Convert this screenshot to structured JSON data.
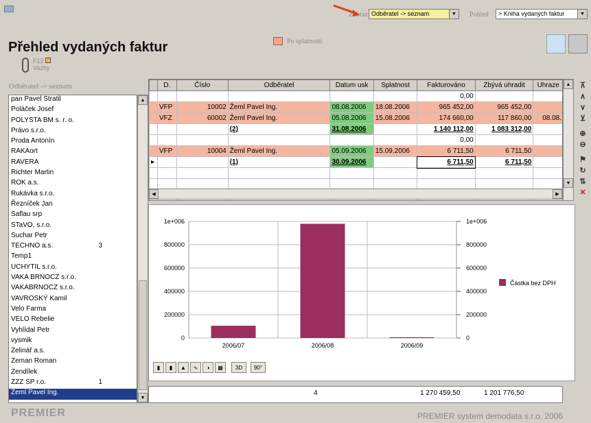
{
  "top": {
    "zobraz_label": "Zobraz",
    "zobraz_value": "Odběratel -> seznam",
    "pohled_label": "Pohled",
    "pohled_value": "> Kniha vydaných faktur"
  },
  "page_title": "Přehled vydaných faktur",
  "legend": {
    "label": "Po splatnosti",
    "color": "#f4a38c"
  },
  "vazby": {
    "key": "F12",
    "label": "Vazby"
  },
  "list_header": "Odběratel -> seznam",
  "customers": [
    {
      "name": "pan Pavel Stratil",
      "n": ""
    },
    {
      "name": "Poláček Josef",
      "n": ""
    },
    {
      "name": "POLYSTA BM s. r. o.",
      "n": ""
    },
    {
      "name": "Právo s.r.o.",
      "n": ""
    },
    {
      "name": "Proda Antonín",
      "n": ""
    },
    {
      "name": "RAKAort",
      "n": ""
    },
    {
      "name": "RAVERA",
      "n": ""
    },
    {
      "name": "Richter Martin",
      "n": ""
    },
    {
      "name": "ROK a.s.",
      "n": ""
    },
    {
      "name": "Rukávka s.r.o.",
      "n": ""
    },
    {
      "name": "Řezníček Jan",
      "n": ""
    },
    {
      "name": "Saflau srp",
      "n": ""
    },
    {
      "name": "STaVO, s.r.o.",
      "n": ""
    },
    {
      "name": "Suchar Petr",
      "n": ""
    },
    {
      "name": "TECHNO a.s.",
      "n": "3"
    },
    {
      "name": "Temp1",
      "n": ""
    },
    {
      "name": "UCHYTIL s.r.o.",
      "n": ""
    },
    {
      "name": "VAKA BRNOCZ s.r.o.",
      "n": ""
    },
    {
      "name": "VAKABRNOCZ s.r.o.",
      "n": ""
    },
    {
      "name": "VAVROSKÝ Kamil",
      "n": ""
    },
    {
      "name": "Velo Farma",
      "n": ""
    },
    {
      "name": "VELO Rebelie",
      "n": ""
    },
    {
      "name": "Vyhlídal Petr",
      "n": ""
    },
    {
      "name": "vysmik",
      "n": ""
    },
    {
      "name": "Zelinář a.s.",
      "n": ""
    },
    {
      "name": "Zeman Roman",
      "n": ""
    },
    {
      "name": "Zendílek",
      "n": ""
    },
    {
      "name": "ZZZ SP r.o.",
      "n": "1"
    },
    {
      "name": "Žeml Pavel Ing.",
      "n": ""
    }
  ],
  "grid": {
    "headers": [
      "D.",
      "Číslo",
      "Odběratel",
      "Datum usk",
      "Splatnost",
      "Fakturováno",
      "Zbývá uhradit",
      "Uhraze"
    ],
    "rows": [
      {
        "style": "plain",
        "cells": [
          "",
          "",
          "",
          "",
          "",
          "0,00",
          "",
          ""
        ]
      },
      {
        "style": "overdue",
        "cells": [
          "VFP",
          "10002",
          "Žeml Pavel Ing.",
          "08.08.2006",
          "18.08.2006",
          "965 452,00",
          "965 452,00",
          ""
        ]
      },
      {
        "style": "overdue",
        "cells": [
          "VFZ",
          "60002",
          "Žeml Pavel Ing.",
          "05.08.2006",
          "15.08.2006",
          "174 660,00",
          "117 860,00",
          "08.08."
        ]
      },
      {
        "style": "sum",
        "cells": [
          "",
          "",
          "(2)",
          "31.08.2006",
          "",
          "1 140 112,00",
          "1 083 312,00",
          ""
        ]
      },
      {
        "style": "plain",
        "cells": [
          "",
          "",
          "",
          "",
          "",
          "0,00",
          "",
          ""
        ]
      },
      {
        "style": "overdue",
        "cells": [
          "VFP",
          "10004",
          "Žeml Pavel Ing.",
          "05.09.2006",
          "15.09.2006",
          "6 711,50",
          "6 711,50",
          ""
        ]
      },
      {
        "style": "sum",
        "cells": [
          "",
          "",
          "(1)",
          "30.09.2006",
          "",
          "6 711,50",
          "6 711,50",
          ""
        ]
      }
    ]
  },
  "totals": {
    "count": "4",
    "fakturovano": "1 270 459,50",
    "zbyva": "1 201 776,50"
  },
  "chart_toolbar": {
    "btn3d": "3D",
    "btn90": "90°"
  },
  "footer": "PREMIER system demodata s.r.o.   2006",
  "chart_data": {
    "type": "bar",
    "categories": [
      "2006/07",
      "2006/08",
      "2006/09"
    ],
    "series": [
      {
        "name": "Částka bez DPH",
        "values": [
          105000,
          980000,
          6711.5
        ],
        "color": "#9b2d5f"
      }
    ],
    "ylim": [
      0,
      1000000
    ],
    "yticks": [
      "0",
      "200000",
      "400000",
      "600000",
      "800000",
      "1e+006"
    ],
    "ytick_values": [
      0,
      200000,
      400000,
      600000,
      800000,
      1000000
    ],
    "legend_position": "right",
    "grid": true
  }
}
